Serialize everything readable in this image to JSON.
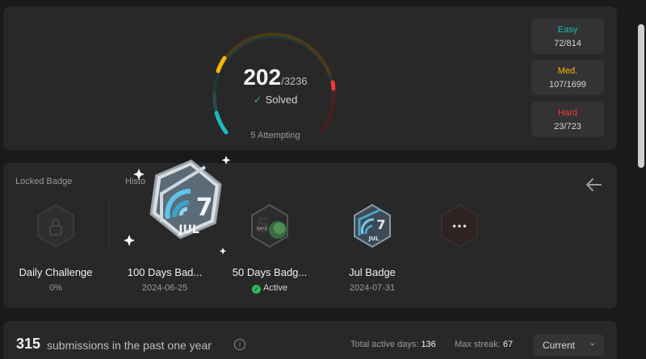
{
  "stats": {
    "solved": "202",
    "total": "/3236",
    "solved_label": "Solved",
    "attempting": "5 Attempting",
    "easy": {
      "label": "Easy",
      "value": "72/814",
      "color": "#1cbaba"
    },
    "medium": {
      "label": "Med.",
      "value": "107/1699",
      "color": "#ffb700"
    },
    "hard": {
      "label": "Hard",
      "value": "23/723",
      "color": "#f63737"
    }
  },
  "badges": {
    "locked_title": "Locked Badge",
    "history_title": "Histo",
    "items": [
      {
        "name": "Daily Challenge",
        "sub": "0%"
      },
      {
        "name": "100 Days Bad...",
        "sub": "2024-06-25"
      },
      {
        "name": "50 Days Badg...",
        "sub": "Active"
      },
      {
        "name": "Jul Badge",
        "sub": "2024-07-31"
      }
    ],
    "big_badge_number": "7",
    "big_badge_month": "JUL",
    "small_jul_number": "7",
    "small_jul_month": "JUL",
    "fifty_days_text": "DAYS",
    "more_glyph": "•••"
  },
  "submissions": {
    "count": "315",
    "text": "submissions in the past one year",
    "active_days_label": "Total active days:",
    "active_days_value": "136",
    "max_streak_label": "Max streak:",
    "max_streak_value": "67",
    "select_value": "Current"
  }
}
